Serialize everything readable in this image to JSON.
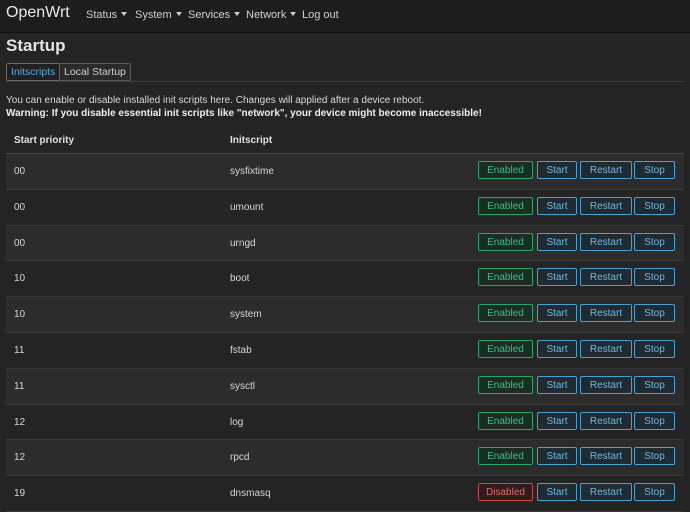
{
  "navbar": {
    "brand": "OpenWrt",
    "items": [
      {
        "label": "Status",
        "dropdown": true
      },
      {
        "label": "System",
        "dropdown": true
      },
      {
        "label": "Services",
        "dropdown": true
      },
      {
        "label": "Network",
        "dropdown": true
      },
      {
        "label": "Log out",
        "dropdown": false
      }
    ]
  },
  "page": {
    "title": "Startup",
    "tabs": [
      {
        "label": "Initscripts",
        "active": true
      },
      {
        "label": "Local Startup",
        "active": false
      }
    ],
    "description": "You can enable or disable installed init scripts here. Changes will applied after a device reboot.",
    "warning": "Warning: If you disable essential init scripts like \"network\", your device might become inaccessible!"
  },
  "table": {
    "headers": {
      "priority": "Start priority",
      "initscript": "Initscript"
    },
    "actions": {
      "start": "Start",
      "restart": "Restart",
      "stop": "Stop"
    },
    "rows": [
      {
        "priority": "00",
        "name": "sysfixtime",
        "state": "Enabled"
      },
      {
        "priority": "00",
        "name": "umount",
        "state": "Enabled"
      },
      {
        "priority": "00",
        "name": "urngd",
        "state": "Enabled"
      },
      {
        "priority": "10",
        "name": "boot",
        "state": "Enabled"
      },
      {
        "priority": "10",
        "name": "system",
        "state": "Enabled"
      },
      {
        "priority": "11",
        "name": "fstab",
        "state": "Enabled"
      },
      {
        "priority": "11",
        "name": "sysctl",
        "state": "Enabled"
      },
      {
        "priority": "12",
        "name": "log",
        "state": "Enabled"
      },
      {
        "priority": "12",
        "name": "rpcd",
        "state": "Enabled"
      },
      {
        "priority": "19",
        "name": "dnsmasq",
        "state": "Disabled"
      }
    ]
  },
  "colors": {
    "enabled": "#37c07e",
    "disabled": "#e06a6a",
    "action": "#6fb8e0",
    "active_tab": "#5aa9d6"
  }
}
